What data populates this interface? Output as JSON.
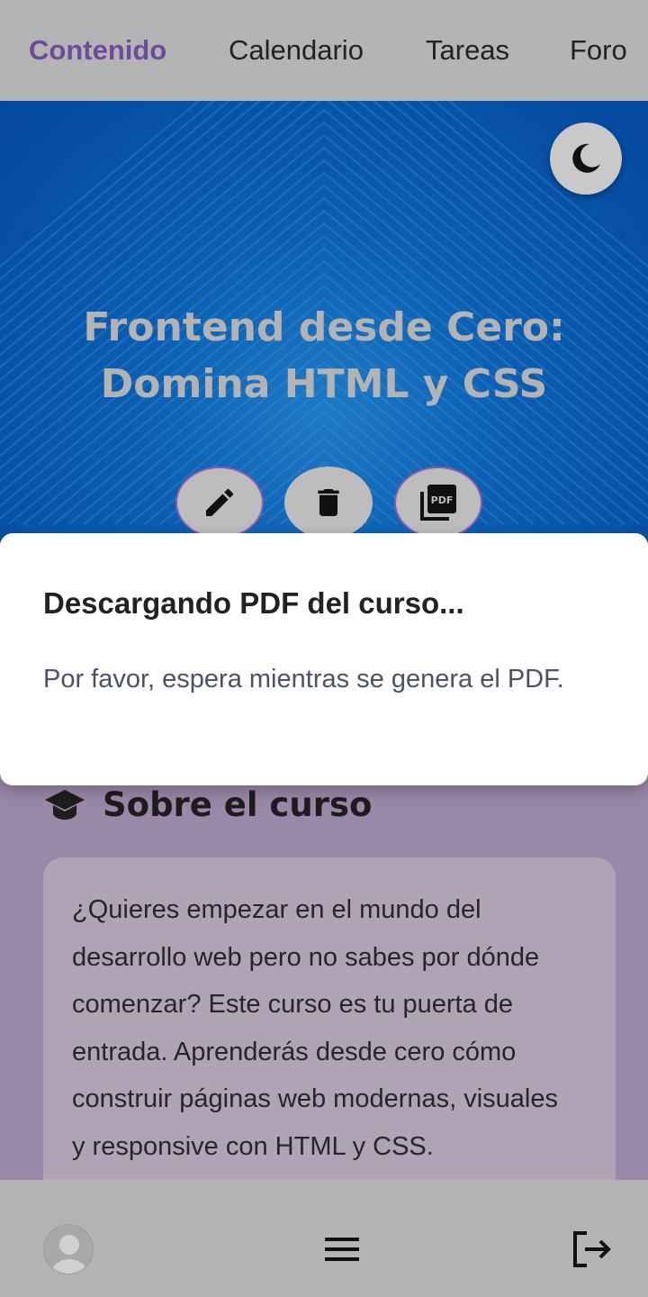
{
  "nav": {
    "tabs": [
      {
        "label": "Contenido",
        "active": true
      },
      {
        "label": "Calendario",
        "active": false
      },
      {
        "label": "Tareas",
        "active": false
      },
      {
        "label": "Foro",
        "active": false
      }
    ]
  },
  "hero": {
    "title_line1": "Frontend desde Cero:",
    "title_line2": "Domina HTML y CSS",
    "actions": {
      "edit_icon": "pencil-icon",
      "delete_icon": "trash-icon",
      "pdf_icon": "pdf-icon"
    },
    "theme_icon": "moon-icon"
  },
  "dialog": {
    "title": "Descargando PDF del curso...",
    "message": "Por favor, espera mientras se genera el PDF."
  },
  "about": {
    "icon": "graduation-cap-icon",
    "title": "Sobre el curso",
    "description": "¿Quieres empezar en el mundo del desarrollo web pero no sabes por dónde comenzar? Este curso es tu puerta de entrada. Aprenderás desde cero cómo construir páginas web modernas, visuales y responsive con HTML y CSS."
  },
  "bottom": {
    "avatar_icon": "user-avatar-icon",
    "menu_icon": "menu-icon",
    "logout_icon": "logout-icon"
  },
  "colors": {
    "active_tab": "#6f4a9c",
    "hero_bg": "#0c5eb2",
    "dialog_bg": "#ffffff",
    "bar_bg": "#b4b4b4"
  }
}
